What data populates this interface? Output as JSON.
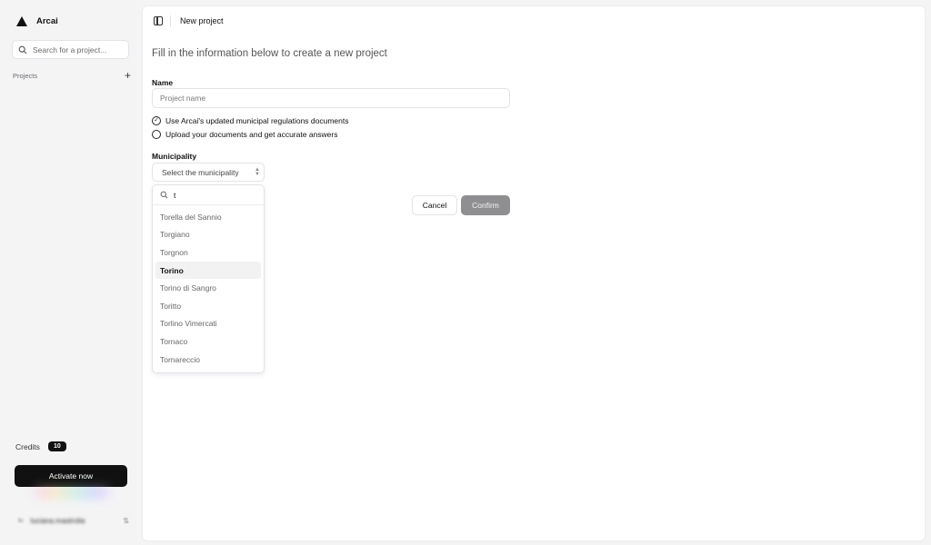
{
  "app": {
    "name": "Arcai"
  },
  "sidebar": {
    "search_placeholder": "Search for a project...",
    "projects_label": "Projects",
    "credits_label": "Credits",
    "credits_value": "10",
    "activate_label": "Activate now",
    "user": {
      "initials": "lu",
      "name": "luciana.mastrolia"
    }
  },
  "header": {
    "title": "New project"
  },
  "form": {
    "intro": "Fill in the information below to create a new project",
    "name_label": "Name",
    "name_placeholder": "Project name",
    "options": [
      {
        "label": "Use Arcai's updated municipal regulations documents",
        "checked": true
      },
      {
        "label": "Upload your documents and get accurate answers",
        "checked": false
      }
    ],
    "municipality_label": "Municipality",
    "municipality_select": "Select the municipality",
    "dropdown": {
      "query": "t",
      "items": [
        "Torella del Sannio",
        "Torgiano",
        "Torgnon",
        "Torino",
        "Torino di Sangro",
        "Toritto",
        "Torlino Vimercati",
        "Tornaco",
        "Tornareccio"
      ],
      "highlighted": "Torino"
    },
    "cancel_label": "Cancel",
    "confirm_label": "Confirm"
  }
}
